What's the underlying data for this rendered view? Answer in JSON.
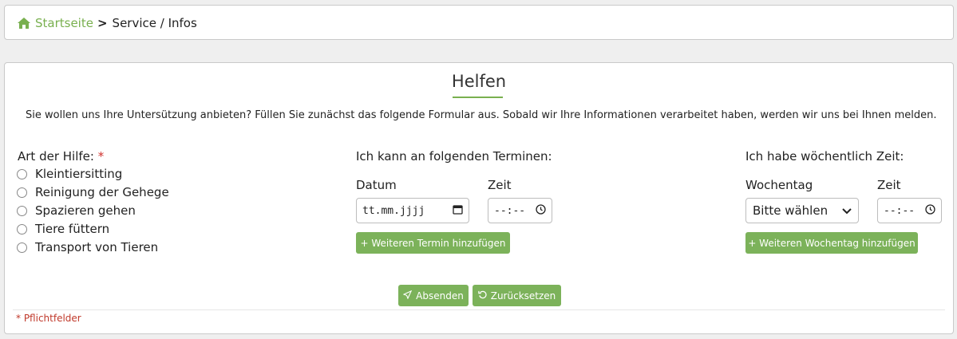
{
  "breadcrumb": {
    "home_label": "Startseite",
    "separator": ">",
    "current": "Service / Infos"
  },
  "form": {
    "title": "Helfen",
    "intro": "Sie wollen uns Ihre Untersützung anbieten? Füllen Sie zunächst das folgende Formular aus. Sobald wir Ihre Informationen verarbeitet haben, werden wir uns bei Ihnen melden.",
    "help_type": {
      "label": "Art der Hilfe:",
      "required_mark": "*",
      "options": [
        "Kleintiersitting",
        "Reinigung der Gehege",
        "Spazieren gehen",
        "Tiere füttern",
        "Transport von Tieren"
      ]
    },
    "dates": {
      "heading": "Ich kann an folgenden Terminen:",
      "date_label": "Datum",
      "date_placeholder": "tt.mm.jjjj",
      "time_label": "Zeit",
      "time_placeholder": "--:--",
      "add_button": "+ Weiteren Termin hinzufügen"
    },
    "weekly": {
      "heading": "Ich habe wöchentlich Zeit:",
      "weekday_label": "Wochentag",
      "weekday_selected": "Bitte wählen",
      "time_label": "Zeit",
      "time_placeholder": "--:--",
      "add_button": "+ Weiteren Wochentag hinzufügen"
    },
    "submit_button": "Absenden",
    "reset_button": "Zurücksetzen",
    "required_note": "* Pflichtfelder"
  },
  "colors": {
    "accent": "#7cb25a",
    "link": "#79b04f",
    "required": "#d0312d"
  },
  "icons": [
    "home-icon",
    "calendar-icon",
    "clock-icon",
    "chevron-down-icon",
    "send-icon",
    "reset-icon"
  ]
}
